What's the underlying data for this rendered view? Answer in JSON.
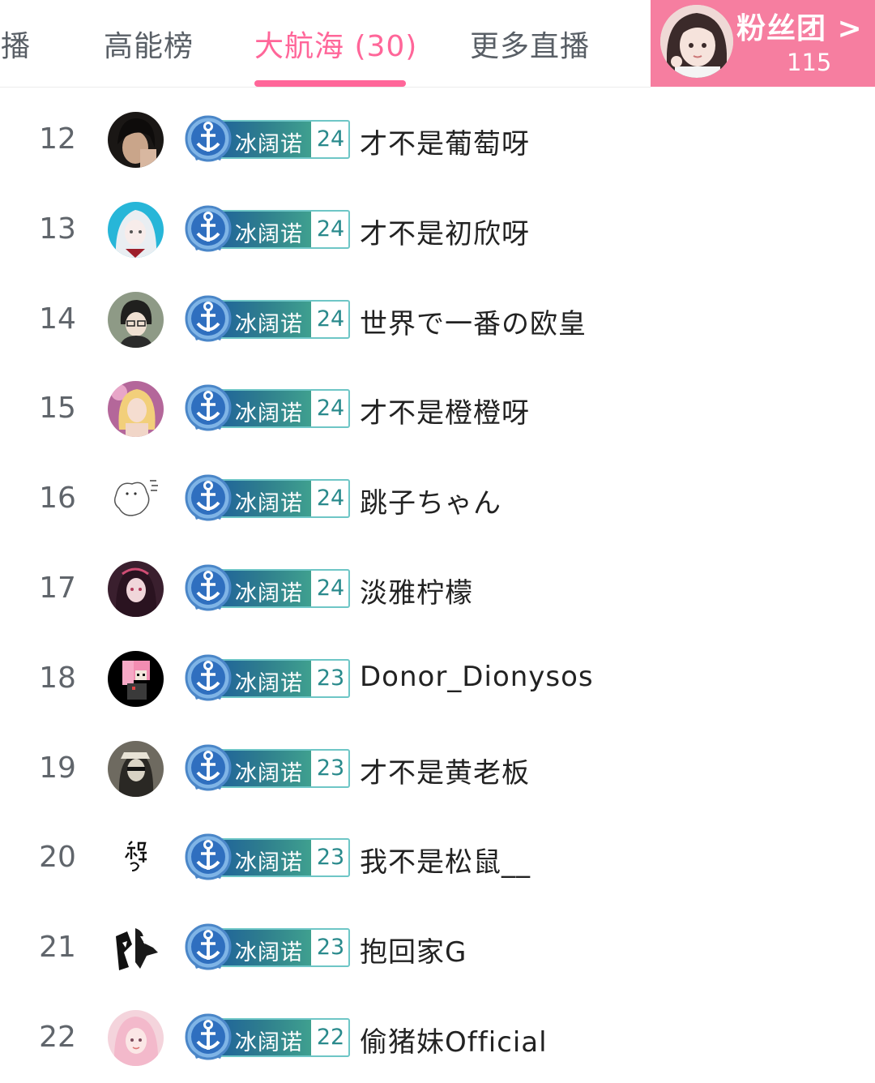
{
  "tabs": [
    {
      "label": "主播"
    },
    {
      "label": "高能榜"
    },
    {
      "label": "大航海 (30)"
    },
    {
      "label": "更多直播"
    }
  ],
  "active_tab_index": 2,
  "fan_club": {
    "label": "粉丝团 >",
    "count": "115"
  },
  "colors": {
    "accent": "#ff6699",
    "fan_club_bg": "#f67ea0",
    "medal_teal": "#3fa08f",
    "medal_blue": "#1a5aa0"
  },
  "medal_icon": "anchor-icon",
  "list": [
    {
      "rank": "12",
      "medal_name": "冰阔诺",
      "medal_level": "24",
      "username": "才不是葡萄呀"
    },
    {
      "rank": "13",
      "medal_name": "冰阔诺",
      "medal_level": "24",
      "username": "才不是初欣呀"
    },
    {
      "rank": "14",
      "medal_name": "冰阔诺",
      "medal_level": "24",
      "username": "世界で一番の欧皇"
    },
    {
      "rank": "15",
      "medal_name": "冰阔诺",
      "medal_level": "24",
      "username": "才不是橙橙呀"
    },
    {
      "rank": "16",
      "medal_name": "冰阔诺",
      "medal_level": "24",
      "username": "跳子ちゃん"
    },
    {
      "rank": "17",
      "medal_name": "冰阔诺",
      "medal_level": "24",
      "username": "淡雅柠檬"
    },
    {
      "rank": "18",
      "medal_name": "冰阔诺",
      "medal_level": "23",
      "username": "Donor_Dionysos"
    },
    {
      "rank": "19",
      "medal_name": "冰阔诺",
      "medal_level": "23",
      "username": "才不是黄老板"
    },
    {
      "rank": "20",
      "medal_name": "冰阔诺",
      "medal_level": "23",
      "username": "我不是松鼠__"
    },
    {
      "rank": "21",
      "medal_name": "冰阔诺",
      "medal_level": "23",
      "username": "抱回家G"
    },
    {
      "rank": "22",
      "medal_name": "冰阔诺",
      "medal_level": "22",
      "username": "偷猪妹Official"
    }
  ]
}
